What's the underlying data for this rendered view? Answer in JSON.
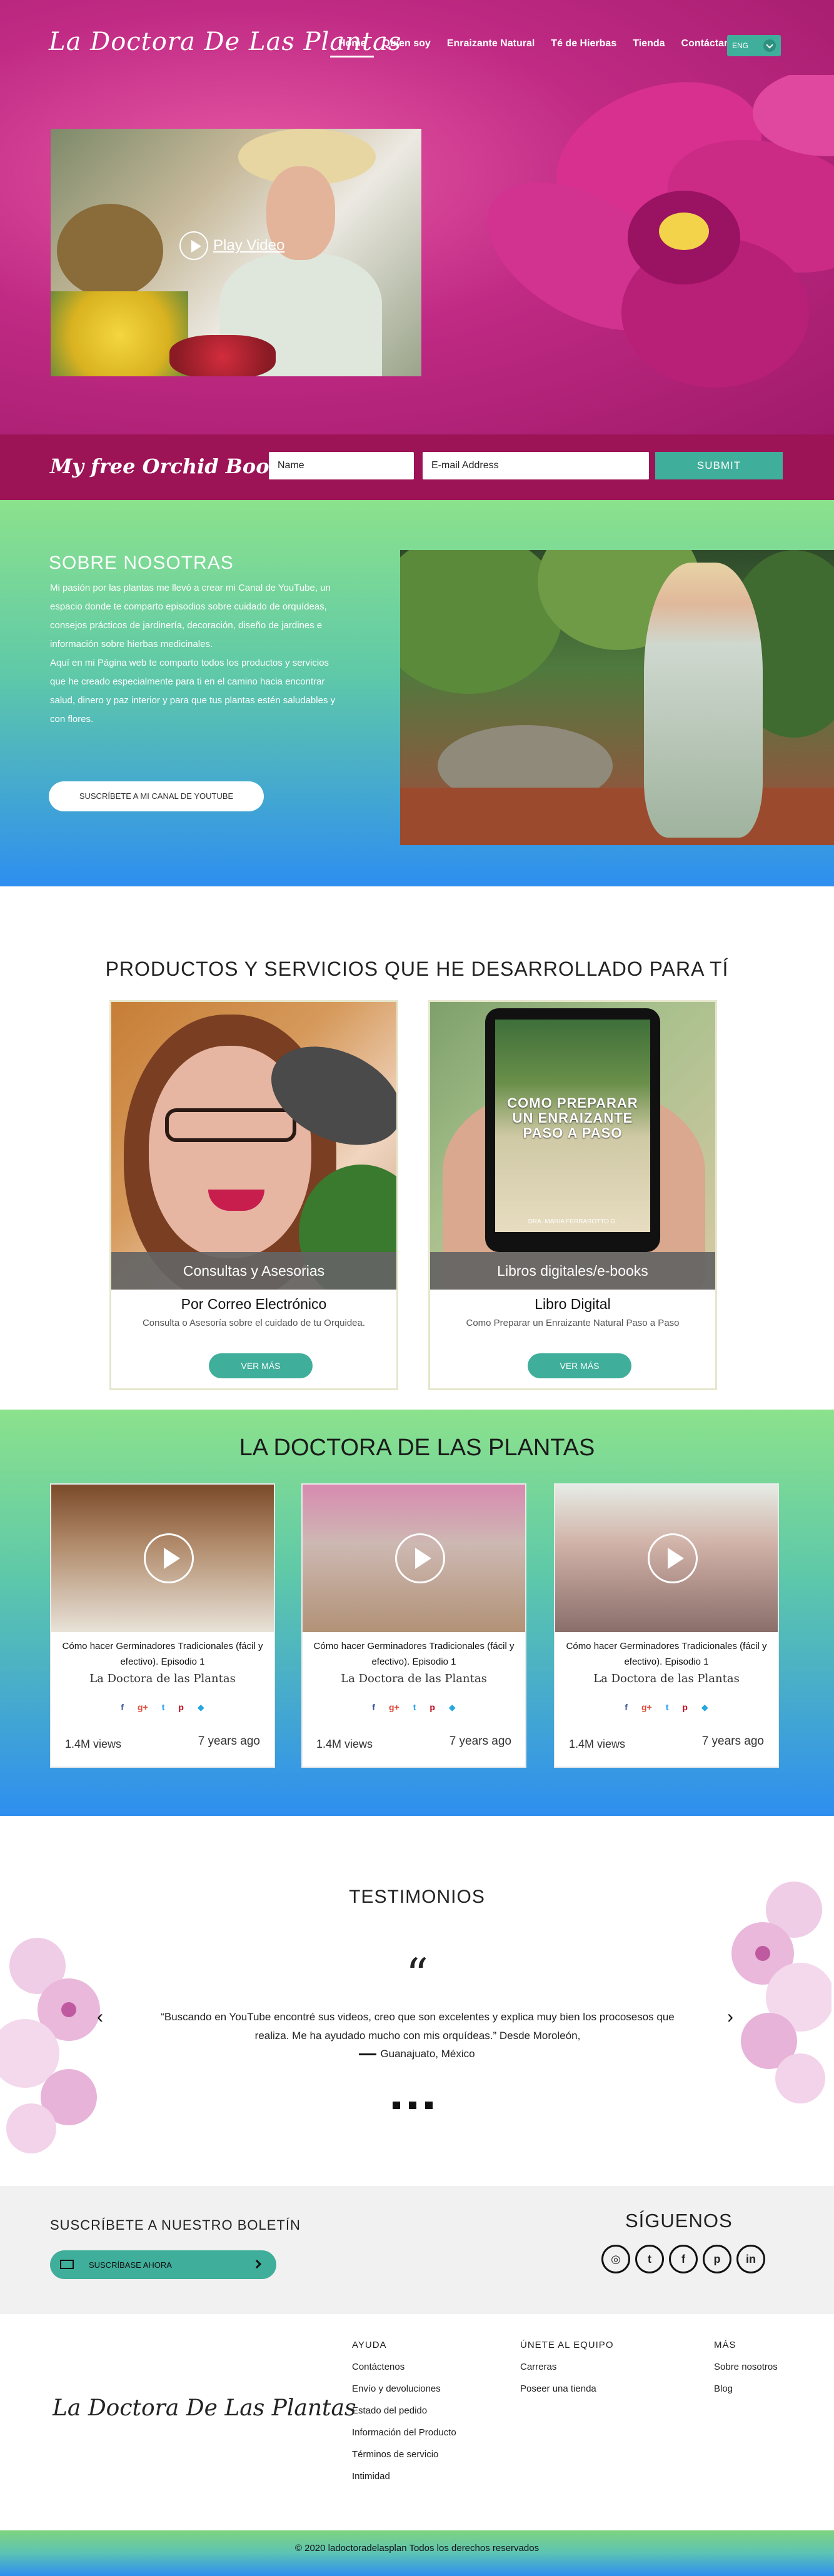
{
  "header": {
    "logo": "La Doctora De Las Plantas",
    "nav": [
      "Home",
      "Quien soy",
      "Enraizante Natural",
      "Té de Hierbas",
      "Tienda",
      "Contáctame"
    ],
    "lang": "ENG"
  },
  "hero": {
    "video_label": "Play Video"
  },
  "orchid_form": {
    "title": "My free Orchid Book now",
    "name_placeholder": "Name",
    "email_placeholder": "E-mail Address",
    "submit": "SUBMIT"
  },
  "about": {
    "title": "SOBRE NOSOTRAS",
    "p1": "Mi pasión por las plantas me llevó a crear mi Canal de YouTube, un espacio donde te comparto episodios sobre cuidado de orquídeas,  consejos prácticos de jardinería, decoración, diseño de jardines e información sobre hierbas medicinales.",
    "p2": "Aquí en mi Página web te comparto todos los productos y servicios que he creado especialmente para ti en el camino hacia encontrar salud, dinero y paz interior y para que tus plantas estén saludables y con flores.",
    "button": "SUSCRÍBETE A MI CANAL DE YOUTUBE"
  },
  "products": {
    "title": "PRODUCTOS Y SERVICIOS QUE HE DESARROLLADO PARA TÍ",
    "cards": [
      {
        "bar": "Consultas y Asesorias",
        "heading": "Por  Correo Electrónico",
        "desc": "Consulta o Asesoría sobre el cuidado de tu Orquidea.",
        "button": "VER MÁS"
      },
      {
        "bar": "Libros digitales/e-books",
        "heading": "Libro Digital",
        "desc": "Como Preparar un Enraizante Natural Paso a Paso",
        "button": "VER MÁS",
        "book_title": "COMO PREPARAR UN ENRAIZANTE PASO A PASO",
        "book_author": "DRA. MARIA FERRAROTTO G."
      }
    ]
  },
  "youtube": {
    "title": "LA DOCTORA DE LAS PLANTAS",
    "videos": [
      {
        "title": "Cómo hacer Germinadores Tradicionales (fácil y efectivo). Episodio 1",
        "channel": "La Doctora de las Plantas",
        "views": "1.4M views",
        "ago": "7 years ago"
      },
      {
        "title": "Cómo hacer Germinadores Tradicionales (fácil y efectivo). Episodio 1",
        "channel": "La Doctora de las Plantas",
        "views": "1.4M views",
        "ago": "7 years ago"
      },
      {
        "title": "Cómo hacer Germinadores Tradicionales (fácil y efectivo). Episodio 1",
        "channel": "La Doctora de las Plantas",
        "views": "1.4M views",
        "ago": "7 years ago"
      }
    ],
    "social_glyphs": [
      "f",
      "g+",
      "t",
      "p",
      "◆"
    ]
  },
  "testimonials": {
    "title": "TESTIMONIOS",
    "quote_mark": "“",
    "quote": "“Buscando en YouTube encontré sus videos, creo que son excelentes y explica muy bien los procosesos que realiza. Me ha ayudado mucho con mis orquídeas.” Desde Moroleón,",
    "author": "Guanajuato, México",
    "prev": "‹",
    "next": "›"
  },
  "newsletter": {
    "title": "SUSCRÍBETE A NUESTRO BOLETÍN",
    "button": "SUSCRÍBASE AHORA",
    "follow_title": "SÍGUENOS",
    "social_glyphs": [
      "◎",
      "t",
      "f",
      "p",
      "in"
    ]
  },
  "footer": {
    "logo": "La Doctora De Las Plantas",
    "col1_title": "AYUDA",
    "col1": [
      "Contáctenos",
      "Envío y devoluciones",
      "Estado del pedido",
      "Información del Producto",
      "Términos de servicio",
      "Intimidad"
    ],
    "col2_title": "ÚNETE AL EQUIPO",
    "col2": [
      "Carreras",
      "Poseer una tienda"
    ],
    "col3_title": "MÁS",
    "col3": [
      "Sobre nosotros",
      "Blog"
    ],
    "copyright": "© 2020 ladoctoradelasplan Todos los derechos reservados"
  },
  "colors": {
    "magenta": "#c02a84",
    "teal": "#3fae9a",
    "bar": "#9c1456",
    "green": "#8ce28c",
    "blue": "#2e8ef0"
  }
}
